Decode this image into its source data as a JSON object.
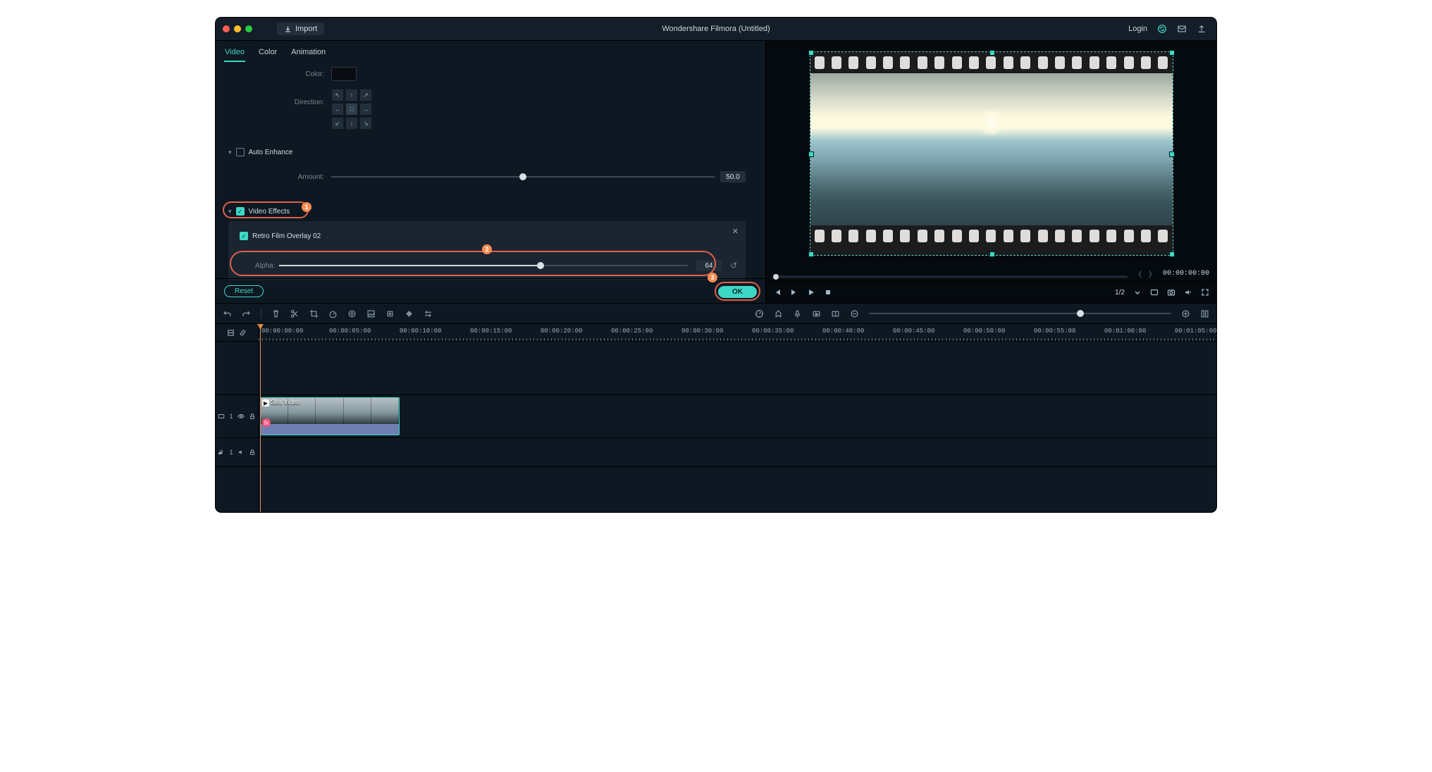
{
  "titlebar": {
    "import_label": "Import",
    "title": "Wondershare Filmora (Untitled)",
    "login": "Login"
  },
  "tabs": {
    "video": "Video",
    "color": "Color",
    "animation": "Animation"
  },
  "panel": {
    "color_label": "Color:",
    "direction_label": "Direction:",
    "auto_enhance": {
      "title": "Auto Enhance",
      "amount_label": "Amount:",
      "amount_value": "50.0"
    },
    "video_effects": {
      "title": "Video Effects",
      "effect_name": "Retro Film Overlay 02",
      "alpha_label": "Alpha:",
      "alpha_value": "64"
    },
    "reset": "Reset",
    "ok": "OK"
  },
  "callouts": {
    "one": "1",
    "two": "2",
    "three": "3"
  },
  "preview": {
    "timecode": "00:00:00:00",
    "ratio": "1/2"
  },
  "timeline": {
    "ruler": [
      "00:00:00:00",
      "00:00:05:00",
      "00:00:10:00",
      "00:00:15:00",
      "00:00:20:00",
      "00:00:25:00",
      "00:00:30:00",
      "00:00:35:00",
      "00:00:40:00",
      "00:00:45:00",
      "00:00:50:00",
      "00:00:55:00",
      "00:01:00:00",
      "00:01:05:00"
    ],
    "video_track_label": "1",
    "audio_track_label": "1",
    "clip_name": "Sea Video",
    "fx_marker": "fx"
  },
  "directions": [
    "↖",
    "↑",
    "↗",
    "←",
    "□",
    "→",
    "↙",
    "↓",
    "↘"
  ]
}
